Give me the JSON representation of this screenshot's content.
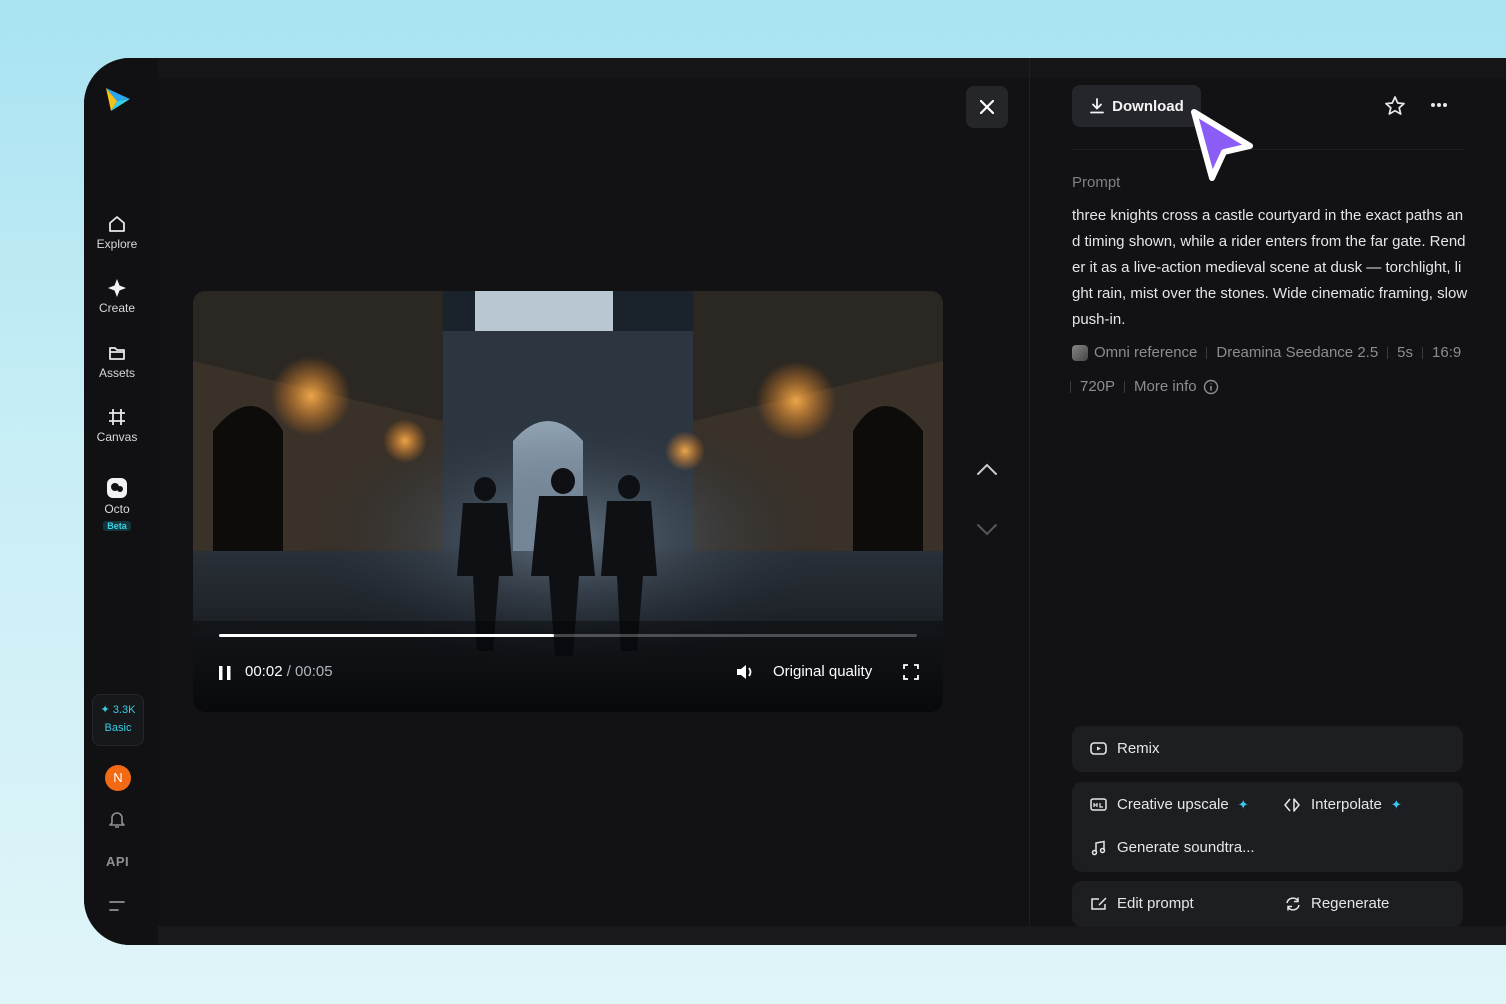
{
  "sidebar": {
    "items": [
      {
        "label": "Explore",
        "icon": "home-icon"
      },
      {
        "label": "Create",
        "icon": "sparkle-icon"
      },
      {
        "label": "Assets",
        "icon": "folder-icon"
      },
      {
        "label": "Canvas",
        "icon": "canvas-icon"
      },
      {
        "label": "Octo",
        "icon": "octo-icon",
        "badge": "Beta"
      }
    ],
    "credits": {
      "amount": "3.3K",
      "plan": "Basic"
    },
    "avatar_initial": "N",
    "api_label": "API"
  },
  "player": {
    "current_time": "00:02",
    "total_time": " / 00:05",
    "quality": "Original quality",
    "progress": 0.48
  },
  "details": {
    "download_label": "Download",
    "prompt_label": "Prompt",
    "prompt_text": "three knights cross a castle courtyard in the exact paths and timing shown, while a rider enters from the far gate. Render it as a live-action medieval scene at dusk — torchlight, light rain, mist over the stones. Wide cinematic framing, slow push-in.",
    "meta": {
      "reference": "Omni reference",
      "model": "Dreamina Seedance",
      "version": "2.5",
      "duration": "5s",
      "ratio": "16:9",
      "resolution": "720P",
      "more_info": "More info"
    },
    "actions": {
      "remix": "Remix",
      "creative_upscale": "Creative upscale",
      "interpolate": "Interpolate",
      "soundtrack": "Generate soundtra...",
      "edit_prompt": "Edit prompt",
      "regenerate": "Regenerate"
    }
  },
  "colors": {
    "accent": "#38cde4",
    "cursor": "#8b5cf6",
    "avatar": "#f36a15"
  }
}
